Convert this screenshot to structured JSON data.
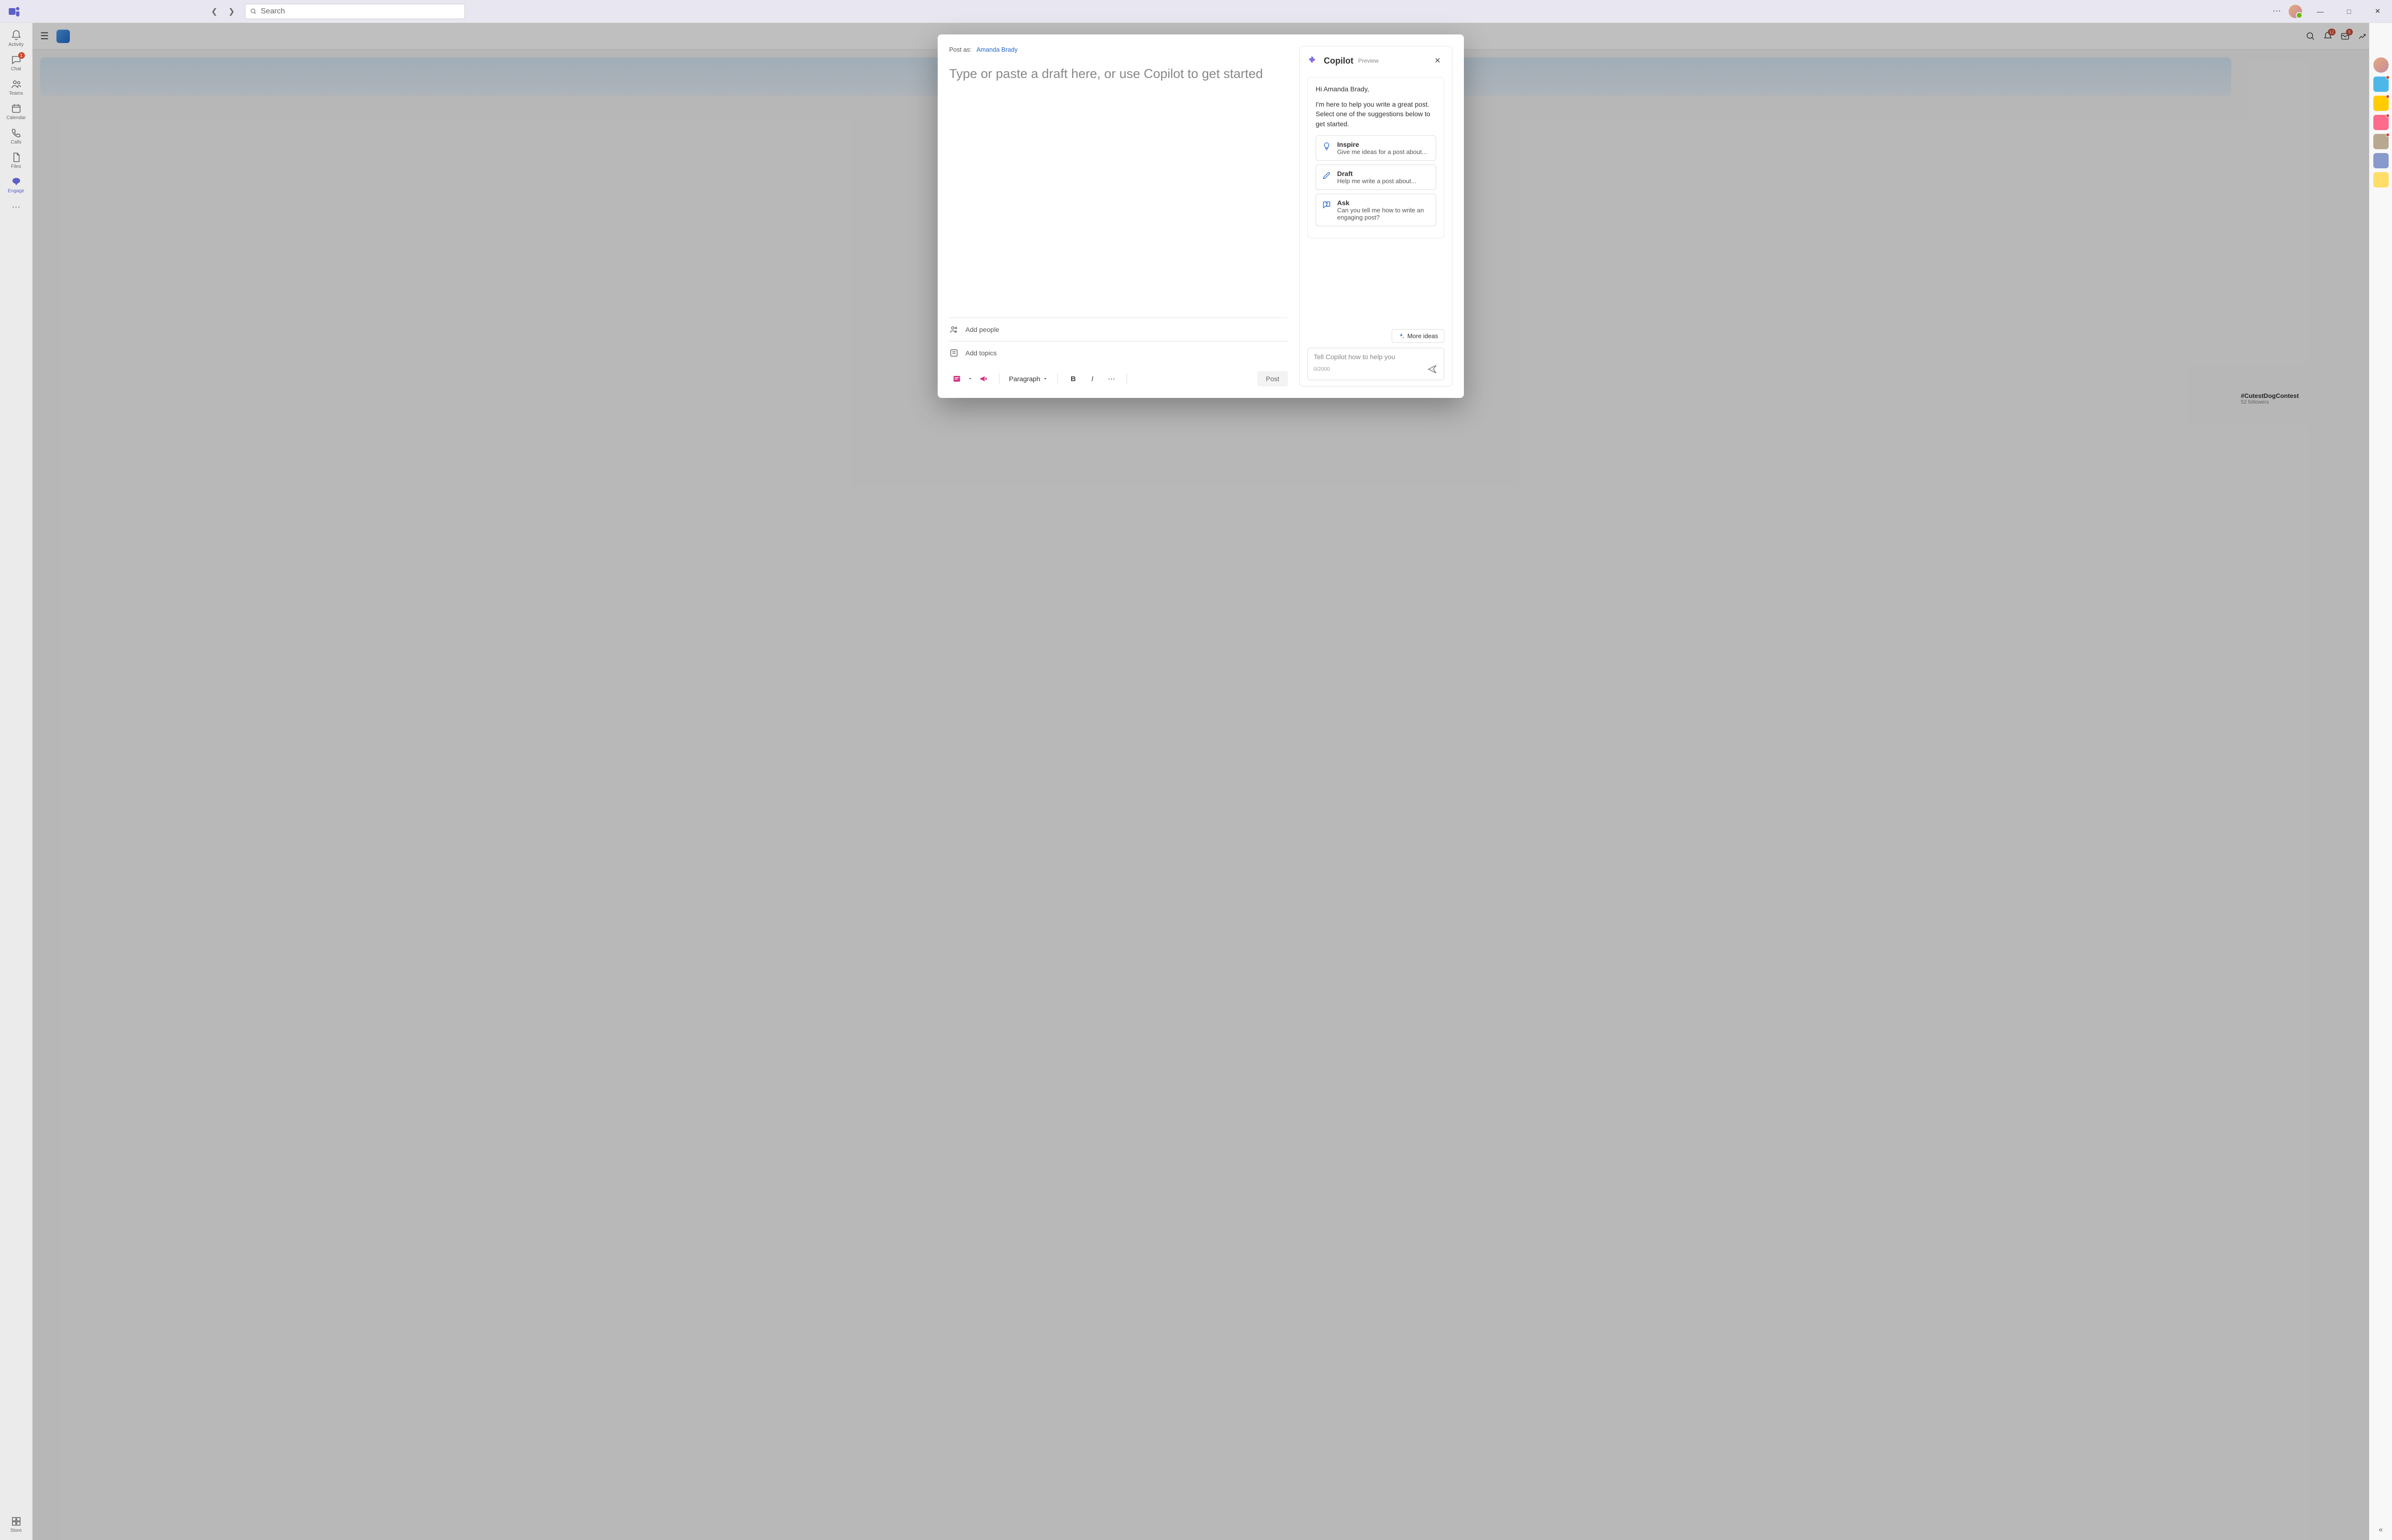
{
  "titlebar": {
    "search_placeholder": "Search"
  },
  "rail": {
    "items": [
      {
        "label": "Activity",
        "badge": ""
      },
      {
        "label": "Chat",
        "badge": "1"
      },
      {
        "label": "Teams",
        "badge": ""
      },
      {
        "label": "Calendar",
        "badge": ""
      },
      {
        "label": "Calls",
        "badge": ""
      },
      {
        "label": "Files",
        "badge": ""
      },
      {
        "label": "Engage",
        "badge": ""
      }
    ],
    "store_label": "Store"
  },
  "header": {
    "notif_badge": "12",
    "inbox_badge": "5"
  },
  "trending": {
    "title": "#CutestDogContest",
    "sub": "52 followers"
  },
  "compose": {
    "post_as_label": "Post as:",
    "post_as_name": "Amanda Brady",
    "placeholder": "Type or paste a draft here, or use Copilot to get started",
    "add_people": "Add people",
    "add_topics": "Add topics",
    "style_label": "Paragraph",
    "post_button": "Post"
  },
  "copilot": {
    "title": "Copilot",
    "preview_tag": "Preview",
    "greeting": "Hi Amanda Brady,",
    "intro": "I'm here to help you write a great post. Select one of the suggestions below to get started.",
    "suggestions": [
      {
        "title": "Inspire",
        "sub": "Give me ideas for a post about..."
      },
      {
        "title": "Draft",
        "sub": "Help me write a post about..."
      },
      {
        "title": "Ask",
        "sub": "Can you tell me how to write an engaging post?"
      }
    ],
    "more_ideas": "More ideas",
    "input_placeholder": "Tell Copilot how to help you",
    "char_count": "0/2000"
  }
}
